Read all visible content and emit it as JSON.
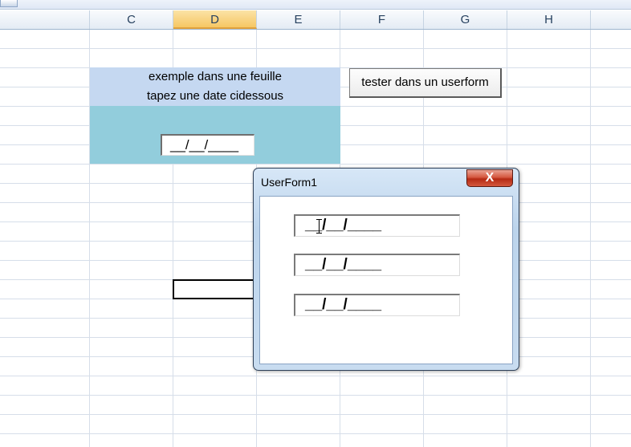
{
  "columns": [
    "C",
    "D",
    "E",
    "F",
    "G",
    "H"
  ],
  "selected_column": "D",
  "sheet": {
    "instruction_line1": "exemple dans une feuille",
    "instruction_line2": "tapez une date cidessous",
    "date_field_value": "__/__/____",
    "button_label": "tester dans un userform"
  },
  "dialog": {
    "title": "UserForm1",
    "close_label": "X",
    "fields": [
      "__/__/____",
      "__/__/____",
      "__/__/____"
    ]
  },
  "colors": {
    "instruction_fill": "#c5d8f1",
    "input_area_fill": "#92cddc",
    "selected_header": "#f6c764",
    "close_button": "#c8402a"
  }
}
